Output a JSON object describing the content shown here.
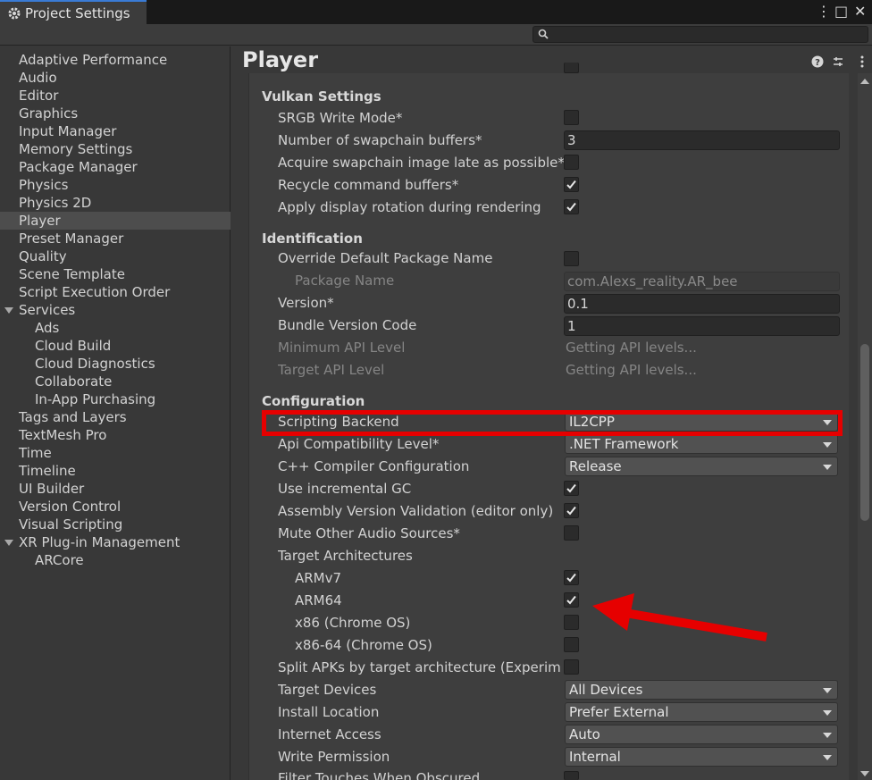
{
  "window": {
    "tab_title": "Project Settings",
    "controls": [
      "⋮",
      "□",
      "✕"
    ]
  },
  "search": {
    "placeholder": ""
  },
  "sidebar": {
    "items": [
      {
        "label": "Adaptive Performance",
        "indent": 0
      },
      {
        "label": "Audio",
        "indent": 0
      },
      {
        "label": "Editor",
        "indent": 0
      },
      {
        "label": "Graphics",
        "indent": 0
      },
      {
        "label": "Input Manager",
        "indent": 0
      },
      {
        "label": "Memory Settings",
        "indent": 0
      },
      {
        "label": "Package Manager",
        "indent": 0
      },
      {
        "label": "Physics",
        "indent": 0
      },
      {
        "label": "Physics 2D",
        "indent": 0
      },
      {
        "label": "Player",
        "indent": 0,
        "selected": true
      },
      {
        "label": "Preset Manager",
        "indent": 0
      },
      {
        "label": "Quality",
        "indent": 0
      },
      {
        "label": "Scene Template",
        "indent": 0
      },
      {
        "label": "Script Execution Order",
        "indent": 0
      },
      {
        "label": "Services",
        "indent": 0,
        "expanded": true
      },
      {
        "label": "Ads",
        "indent": 1
      },
      {
        "label": "Cloud Build",
        "indent": 1
      },
      {
        "label": "Cloud Diagnostics",
        "indent": 1
      },
      {
        "label": "Collaborate",
        "indent": 1
      },
      {
        "label": "In-App Purchasing",
        "indent": 1
      },
      {
        "label": "Tags and Layers",
        "indent": 0
      },
      {
        "label": "TextMesh Pro",
        "indent": 0
      },
      {
        "label": "Time",
        "indent": 0
      },
      {
        "label": "Timeline",
        "indent": 0
      },
      {
        "label": "UI Builder",
        "indent": 0
      },
      {
        "label": "Version Control",
        "indent": 0
      },
      {
        "label": "Visual Scripting",
        "indent": 0
      },
      {
        "label": "XR Plug-in Management",
        "indent": 0,
        "expanded": true
      },
      {
        "label": "ARCore",
        "indent": 1
      }
    ]
  },
  "main": {
    "title": "Player",
    "sections": {
      "vulkan": "Vulkan Settings",
      "identification": "Identification",
      "configuration": "Configuration"
    },
    "vulkan": {
      "srgb": "SRGB Write Mode*",
      "swapchain": "Number of swapchain buffers*",
      "swapchain_value": "3",
      "acquire": "Acquire swapchain image late as possible*",
      "recycle": "Recycle command buffers*",
      "rotation": "Apply display rotation during rendering"
    },
    "identification": {
      "override": "Override Default Package Name",
      "package_name": "Package Name",
      "package_value": "com.Alexs_reality.AR_bee",
      "version": "Version*",
      "version_value": "0.1",
      "bundle": "Bundle Version Code",
      "bundle_value": "1",
      "min_api": "Minimum API Level",
      "min_api_value": "Getting API levels...",
      "target_api": "Target API Level",
      "target_api_value": "Getting API levels..."
    },
    "configuration": {
      "scripting_backend": "Scripting Backend",
      "scripting_backend_value": "IL2CPP",
      "api_compat": "Api Compatibility Level*",
      "api_compat_value": ".NET Framework",
      "cpp_compiler": "C++ Compiler Configuration",
      "cpp_compiler_value": "Release",
      "incremental_gc": "Use incremental GC",
      "assembly_validation": "Assembly Version Validation (editor only)",
      "mute_audio": "Mute Other Audio Sources*",
      "target_arch": "Target Architectures",
      "armv7": "ARMv7",
      "arm64": "ARM64",
      "x86": "x86 (Chrome OS)",
      "x86_64": "x86-64 (Chrome OS)",
      "split_apks": "Split APKs by target architecture (Experimental)",
      "target_devices": "Target Devices",
      "target_devices_value": "All Devices",
      "install_location": "Install Location",
      "install_location_value": "Prefer External",
      "internet_access": "Internet Access",
      "internet_access_value": "Auto",
      "write_permission": "Write Permission",
      "write_permission_value": "Internal",
      "filter_touches": "Filter Touches When Obscured"
    },
    "checks": {
      "srgb": false,
      "acquire": false,
      "recycle": true,
      "rotation": true,
      "override": false,
      "incremental_gc": true,
      "assembly_validation": true,
      "mute_audio": false,
      "armv7": true,
      "arm64": true,
      "x86": false,
      "x86_64": false,
      "split_apks": false
    }
  },
  "colors": {
    "highlight": "#e60000",
    "selected_row": "#4d4d4d",
    "accent_tab": "#3a7bd5"
  }
}
